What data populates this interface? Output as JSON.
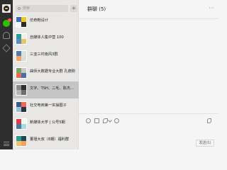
{
  "sidebar": {
    "icons": [
      "avatar",
      "chat-icon",
      "contacts-icon",
      "favorites-icon",
      "menu-icon"
    ]
  },
  "search": {
    "placeholder": "搜索",
    "add_label": "+"
  },
  "chats": [
    {
      "name": "仿奇鞋设计",
      "thumb": [
        "#3a6fb0",
        "#f3c623",
        "#f5f5f5",
        "#2b2b2b"
      ]
    },
    {
      "name": "自媒体人集中营  100",
      "thumb": [
        "#2a9d8f",
        "#f0f0f0",
        "#5b8cc8",
        "#e9c46a"
      ]
    },
    {
      "name": "三亚三村南风3群",
      "thumb": [
        "#4f7cac",
        "#d8e2dc",
        "#f4a261",
        "#dddddd"
      ]
    },
    {
      "name": "曲师大数据专业大群 孔德刚",
      "thumb": [
        "#7aa36b",
        "#c8c8c8",
        "#e76f51",
        "#4a6fa5"
      ]
    },
    {
      "name": "文字、TSH、二毛、陈杰...",
      "thumb": [
        "#8a8a8a",
        "#2f2f2f",
        "#b5b5b5",
        "#6d6d6d"
      ]
    },
    {
      "name": "社交电商第一实操圈子",
      "thumb": [
        "#3d5a80",
        "#ee6c4d",
        "#98c1d9",
        "#293241"
      ]
    },
    {
      "name": "新媒体大学 | 公号5期",
      "thumb": [
        "#e63946",
        "#f1faee",
        "#457b9d",
        "#a8dadc"
      ]
    },
    {
      "name": "董瑾大叔（8期）福利群",
      "thumb": [
        "#2a9d8f",
        "#264653",
        "#e9c46a",
        "#f4a261"
      ]
    }
  ],
  "main": {
    "title": "群聊 (5)",
    "more": "···",
    "send_label": "发送(S)"
  }
}
